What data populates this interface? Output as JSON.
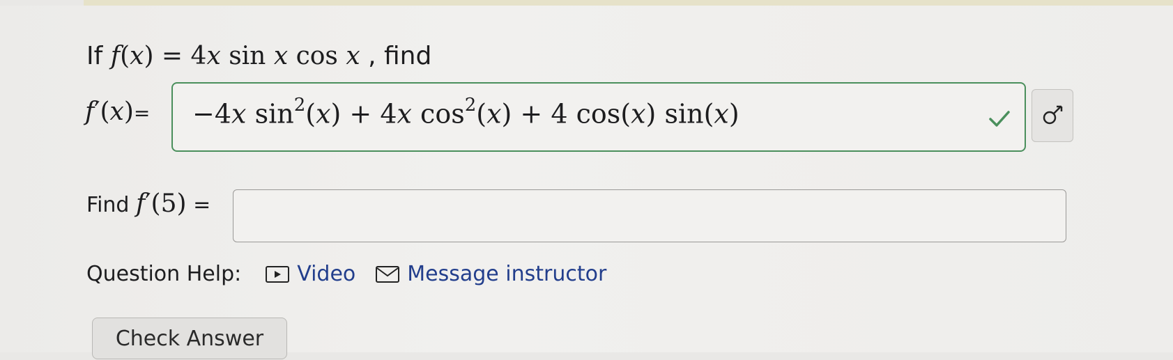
{
  "question": {
    "prefix": "If",
    "function": "f(x) = 4x sin x cos x",
    "suffix": ", find"
  },
  "derivative": {
    "label": "f′(x)",
    "equals": "=",
    "answer": "−4x sin²(x) + 4x cos²(x) + 4 cos(x) sin(x)",
    "status": "correct",
    "status_color": "#4a8f5c"
  },
  "evaluate": {
    "label_prefix": "Find",
    "label_math": "f′(5)",
    "label_equals": "=",
    "value": ""
  },
  "help": {
    "label": "Question Help:",
    "video_label": "Video",
    "message_label": "Message instructor",
    "link_color": "#223e8c"
  },
  "check_button_label": "Check Answer",
  "icons": {
    "status": "checkmark-icon",
    "preview": "formula-preview-icon",
    "video": "video-play-icon",
    "message": "envelope-icon"
  }
}
